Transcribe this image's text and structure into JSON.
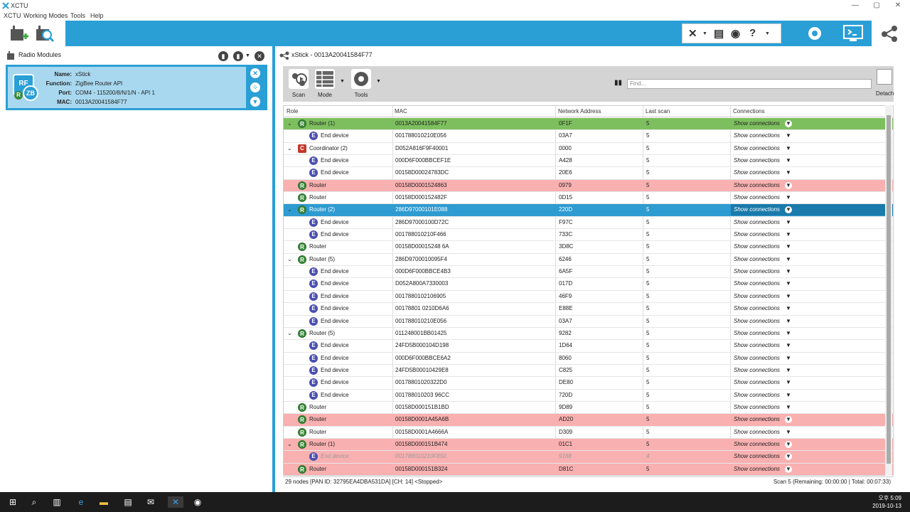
{
  "window": {
    "title": "XCTU",
    "controls": [
      "—",
      "▢",
      "✕"
    ]
  },
  "menu": [
    "XCTU",
    "Working Modes",
    "Tools",
    "Help"
  ],
  "left_panel": {
    "title": "Radio Modules",
    "module": {
      "badge_top": "RF",
      "badge_bottom": "ZB",
      "badge_r": "R",
      "fields": [
        {
          "label": "Name:",
          "value": "xStick"
        },
        {
          "label": "Function:",
          "value": "ZigBee Router API"
        },
        {
          "label": "Port:",
          "value": "COM4 - 115200/8/N/1/N - API 1"
        },
        {
          "label": "MAC:",
          "value": "0013A20041584F77"
        }
      ]
    }
  },
  "right_panel": {
    "title": "xStick - 0013A20041584F77",
    "toolbar": {
      "scan": "Scan",
      "mode": "Mode",
      "tools": "Tools",
      "find_placeholder": "Find...",
      "detach": "Detach"
    },
    "columns": [
      "Role",
      "MAC",
      "Network Address",
      "Last scan",
      "Connections"
    ],
    "rows": [
      {
        "exp": "v",
        "icon": "R",
        "role": "Router (1)",
        "mac": "0013A20041584F77",
        "addr": "0F1F",
        "scan": "5",
        "conn": "Show connections",
        "style": "green",
        "indent": 0
      },
      {
        "exp": "",
        "icon": "E",
        "role": "End device",
        "mac": "001788010210E056",
        "addr": "03A7",
        "scan": "5",
        "conn": "Show connections",
        "style": "",
        "indent": 1
      },
      {
        "exp": "v",
        "icon": "C",
        "role": "Coordinator (2)",
        "mac": "D052A816F9F40001",
        "addr": "0000",
        "scan": "5",
        "conn": "Show connections",
        "style": "",
        "indent": 0
      },
      {
        "exp": "",
        "icon": "E",
        "role": "End device",
        "mac": "000D6F000BBCEF1E",
        "addr": "A428",
        "scan": "5",
        "conn": "Show connections",
        "style": "",
        "indent": 1
      },
      {
        "exp": "",
        "icon": "E",
        "role": "End device",
        "mac": "00158D00024783DC",
        "addr": "20E6",
        "scan": "5",
        "conn": "Show connections",
        "style": "",
        "indent": 1
      },
      {
        "exp": "",
        "icon": "R",
        "role": "Router",
        "mac": "00158D0001524863",
        "addr": "0979",
        "scan": "5",
        "conn": "Show connections",
        "style": "red",
        "indent": 0
      },
      {
        "exp": "",
        "icon": "R",
        "role": "Router",
        "mac": "00158D000152482F",
        "addr": "0D15",
        "scan": "5",
        "conn": "Show connections",
        "style": "",
        "indent": 0
      },
      {
        "exp": "v",
        "icon": "R",
        "role": "Router (2)",
        "mac": "286D97000101E088",
        "addr": "220D",
        "scan": "5",
        "conn": "Show connections",
        "style": "blue",
        "indent": 0
      },
      {
        "exp": "",
        "icon": "E",
        "role": "End device",
        "mac": "286D97000100D72C",
        "addr": "F97C",
        "scan": "5",
        "conn": "Show connections",
        "style": "",
        "indent": 1
      },
      {
        "exp": "",
        "icon": "E",
        "role": "End device",
        "mac": "001788010210F466",
        "addr": "733C",
        "scan": "5",
        "conn": "Show connections",
        "style": "",
        "indent": 1
      },
      {
        "exp": "",
        "icon": "R",
        "role": "Router",
        "mac": "00158D00015248 6A",
        "addr": "3D8C",
        "scan": "5",
        "conn": "Show connections",
        "style": "",
        "indent": 0
      },
      {
        "exp": "v",
        "icon": "R",
        "role": "Router (5)",
        "mac": "286D9700010095F4",
        "addr": "6246",
        "scan": "5",
        "conn": "Show connections",
        "style": "",
        "indent": 0
      },
      {
        "exp": "",
        "icon": "E",
        "role": "End device",
        "mac": "000D6F000BBCE4B3",
        "addr": "6A5F",
        "scan": "5",
        "conn": "Show connections",
        "style": "",
        "indent": 1
      },
      {
        "exp": "",
        "icon": "E",
        "role": "End device",
        "mac": "D052A800A7330003",
        "addr": "017D",
        "scan": "5",
        "conn": "Show connections",
        "style": "",
        "indent": 1
      },
      {
        "exp": "",
        "icon": "E",
        "role": "End device",
        "mac": "0017880102106905",
        "addr": "46F9",
        "scan": "5",
        "conn": "Show connections",
        "style": "",
        "indent": 1
      },
      {
        "exp": "",
        "icon": "E",
        "role": "End device",
        "mac": "00178801 0210D6A6",
        "addr": "E88E",
        "scan": "5",
        "conn": "Show connections",
        "style": "",
        "indent": 1
      },
      {
        "exp": "",
        "icon": "E",
        "role": "End device",
        "mac": "001788010210E056",
        "addr": "03A7",
        "scan": "5",
        "conn": "Show connections",
        "style": "",
        "indent": 1
      },
      {
        "exp": "v",
        "icon": "R",
        "role": "Router (5)",
        "mac": "011248001BB01425",
        "addr": "9282",
        "scan": "5",
        "conn": "Show connections",
        "style": "",
        "indent": 0
      },
      {
        "exp": "",
        "icon": "E",
        "role": "End device",
        "mac": "24FD5B000104D198",
        "addr": "1D64",
        "scan": "5",
        "conn": "Show connections",
        "style": "",
        "indent": 1
      },
      {
        "exp": "",
        "icon": "E",
        "role": "End device",
        "mac": "000D6F000BBCE6A2",
        "addr": "8060",
        "scan": "5",
        "conn": "Show connections",
        "style": "",
        "indent": 1
      },
      {
        "exp": "",
        "icon": "E",
        "role": "End device",
        "mac": "24FD5B00010429E8",
        "addr": "C825",
        "scan": "5",
        "conn": "Show connections",
        "style": "",
        "indent": 1
      },
      {
        "exp": "",
        "icon": "E",
        "role": "End device",
        "mac": "00178801020322D0",
        "addr": "DE80",
        "scan": "5",
        "conn": "Show connections",
        "style": "",
        "indent": 1
      },
      {
        "exp": "",
        "icon": "E",
        "role": "End device",
        "mac": "001788010203 96CC",
        "addr": "720D",
        "scan": "5",
        "conn": "Show connections",
        "style": "",
        "indent": 1
      },
      {
        "exp": "",
        "icon": "R",
        "role": "Router",
        "mac": "00158D000151B1BD",
        "addr": "9D89",
        "scan": "5",
        "conn": "Show connections",
        "style": "",
        "indent": 0
      },
      {
        "exp": "",
        "icon": "R",
        "role": "Router",
        "mac": "00158D0001A45A6B",
        "addr": "AD20",
        "scan": "5",
        "conn": "Show connections",
        "style": "red",
        "indent": 0
      },
      {
        "exp": "",
        "icon": "R",
        "role": "Router",
        "mac": "00158D0001A4666A",
        "addr": "D309",
        "scan": "5",
        "conn": "Show connections",
        "style": "",
        "indent": 0
      },
      {
        "exp": "v",
        "icon": "R",
        "role": "Router (1)",
        "mac": "00158D000151B474",
        "addr": "01C1",
        "scan": "5",
        "conn": "Show connections",
        "style": "red",
        "indent": 0
      },
      {
        "exp": "",
        "icon": "E",
        "role": "End device",
        "mac": "001788010210F850",
        "addr": "9188",
        "scan": "4",
        "conn": "Show connections",
        "style": "red-dim",
        "indent": 1
      },
      {
        "exp": "",
        "icon": "R",
        "role": "Router",
        "mac": "00158D000151B324",
        "addr": "D81C",
        "scan": "5",
        "conn": "Show connections",
        "style": "red",
        "indent": 0
      }
    ],
    "status_left": "29 nodes [PAN ID: 32795EA4DBA531DA] [CH: 14] <Stopped>",
    "status_right": "Scan 5 (Remaining: 00:00:00 | Total: 00:07:33)"
  },
  "taskbar": {
    "time": "오후 5:09",
    "date": "2019-10-13"
  }
}
